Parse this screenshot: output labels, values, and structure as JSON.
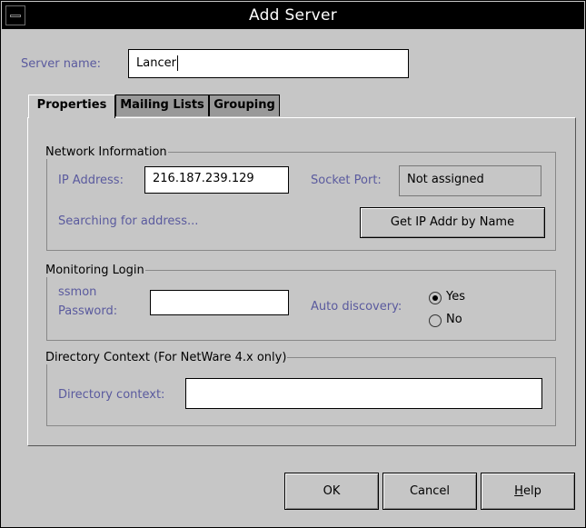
{
  "window": {
    "title": "Add Server"
  },
  "server": {
    "label": "Server name:",
    "value": "Lancer"
  },
  "tabs": [
    {
      "label": "Properties",
      "active": true
    },
    {
      "label": "Mailing Lists",
      "active": false
    },
    {
      "label": "Grouping",
      "active": false
    }
  ],
  "network": {
    "legend": "Network Information",
    "ip_label": "IP Address:",
    "ip_value": "216.187.239.129",
    "port_label": "Socket Port:",
    "port_value": "Not assigned",
    "status": "Searching for address...",
    "get_ip_button": "Get IP Addr by Name"
  },
  "monitoring": {
    "legend": "Monitoring Login",
    "user": "ssmon",
    "password_label": "Password:",
    "password_value": "",
    "auto_label": "Auto discovery:",
    "yes_label": "Yes",
    "no_label": "No",
    "auto_selected": "Yes"
  },
  "directory": {
    "legend": "Directory Context (For NetWare 4.x only)",
    "label": "Directory context:",
    "value": ""
  },
  "buttons": {
    "ok": "OK",
    "cancel": "Cancel",
    "help_mnemonic": "H",
    "help_rest": "elp"
  },
  "colors": {
    "dialog_bg": "#c6c6c6",
    "titlebar": "#000000",
    "label_text": "#5a5a9e",
    "inactive_tab": "#999999"
  }
}
